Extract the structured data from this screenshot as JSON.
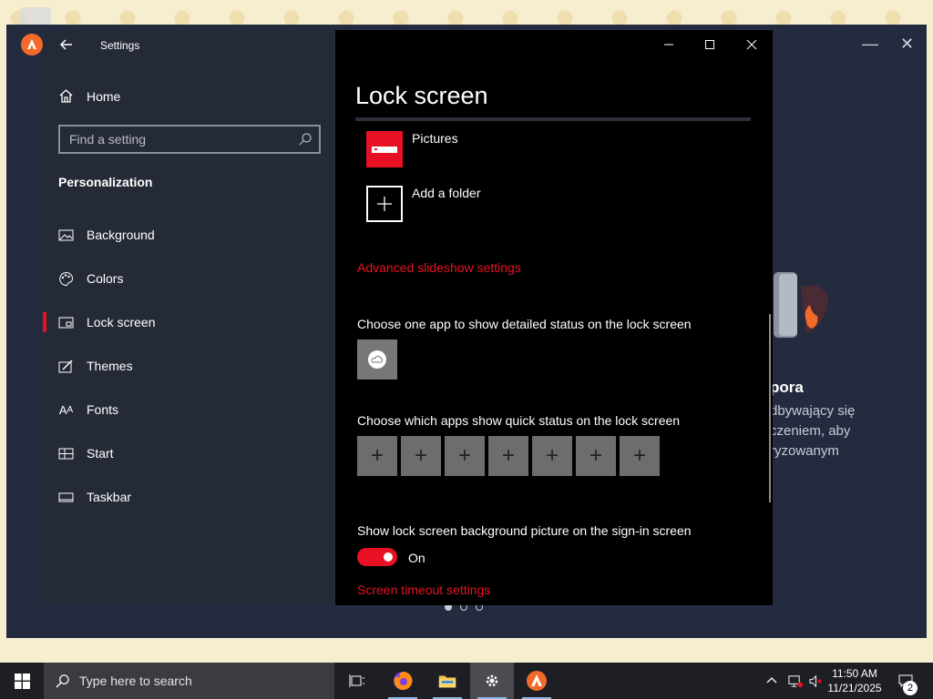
{
  "settings_window": {
    "title": "Settings",
    "home_label": "Home",
    "search_placeholder": "Find a setting",
    "section_title": "Personalization",
    "nav_items": [
      {
        "label": "Background",
        "icon": "picture-icon"
      },
      {
        "label": "Colors",
        "icon": "palette-icon"
      },
      {
        "label": "Lock screen",
        "icon": "lock-screen-icon",
        "selected": true
      },
      {
        "label": "Themes",
        "icon": "brush-icon"
      },
      {
        "label": "Fonts",
        "icon": "font-icon"
      },
      {
        "label": "Start",
        "icon": "start-grid-icon"
      },
      {
        "label": "Taskbar",
        "icon": "taskbar-icon"
      }
    ]
  },
  "lock_screen": {
    "page_title": "Lock screen",
    "folders": [
      {
        "label": "Pictures",
        "icon": "pictures-folder-icon"
      },
      {
        "label": "Add a folder",
        "icon": "plus-icon"
      }
    ],
    "advanced_slideshow_link": "Advanced slideshow settings",
    "detailed_status_label": "Choose one app to show detailed status on the lock screen",
    "detailed_status_app_icon": "weather-icon",
    "quick_status_label": "Choose which apps show quick status on the lock screen",
    "quick_status_slots": [
      "+",
      "+",
      "+",
      "+",
      "+",
      "+",
      "+"
    ],
    "signin_background_label": "Show lock screen background picture on the sign-in screen",
    "signin_background_toggle": {
      "state": "On",
      "on": true
    },
    "screen_timeout_link": "Screen timeout settings"
  },
  "background_app": {
    "heading_fragment": "pora",
    "text_lines": [
      "dbywający się",
      "czeniem, aby",
      "ryzowanym"
    ],
    "pager_pages": 3,
    "pager_active": 1
  },
  "taskbar": {
    "search_placeholder": "Type here to search",
    "apps": [
      "task-view-icon",
      "firefox-icon",
      "file-explorer-icon",
      "settings-icon",
      "avast-icon"
    ],
    "active_app": "settings-icon",
    "time": "11:50 AM",
    "date": "11/21/2025",
    "notification_count": "2"
  },
  "colors": {
    "accent": "#e81123",
    "settings_nav_bg": "#252a37",
    "settings_content_bg": "#000000",
    "app_bg": "#242b3f",
    "taskbar_bg": "#1d1f24"
  }
}
